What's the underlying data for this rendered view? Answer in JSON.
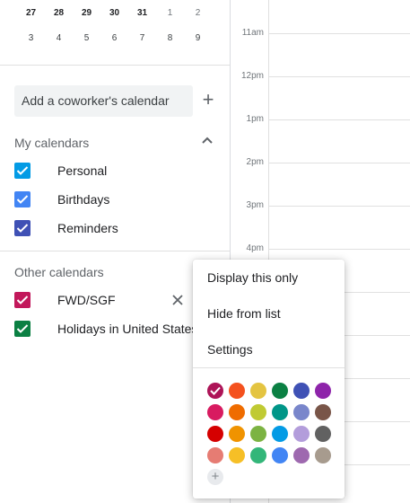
{
  "mini_calendar": {
    "row1": [
      {
        "d": "27"
      },
      {
        "d": "28"
      },
      {
        "d": "29"
      },
      {
        "d": "30"
      },
      {
        "d": "31"
      },
      {
        "d": "1"
      },
      {
        "d": "2"
      }
    ],
    "row2": [
      {
        "d": "3"
      },
      {
        "d": "4"
      },
      {
        "d": "5"
      },
      {
        "d": "6"
      },
      {
        "d": "7"
      },
      {
        "d": "8"
      },
      {
        "d": "9"
      }
    ]
  },
  "coworker": {
    "placeholder": "Add a coworker's calendar",
    "add_icon": "plus-icon"
  },
  "my_calendars": {
    "title": "My calendars",
    "items": [
      {
        "label": "Personal",
        "color": "#039be5"
      },
      {
        "label": "Birthdays",
        "color": "#4285f4"
      },
      {
        "label": "Reminders",
        "color": "#3f51b5"
      }
    ]
  },
  "other_calendars": {
    "title": "Other calendars",
    "items": [
      {
        "label": "FWD/SGF",
        "color": "#c2185b"
      },
      {
        "label": "Holidays in United States",
        "color": "#0b8043"
      }
    ]
  },
  "time_grid": {
    "hours": [
      "11am",
      "12pm",
      "1pm",
      "2pm",
      "3pm",
      "4pm"
    ]
  },
  "context_menu": {
    "items": [
      "Display this only",
      "Hide from list",
      "Settings"
    ],
    "selected_color": "#ad1457",
    "colors": [
      [
        "#ad1457",
        "#f4511e",
        "#e4c441",
        "#0b8043",
        "#3f51b5",
        "#8e24aa"
      ],
      [
        "#d81b60",
        "#ef6c00",
        "#c0ca33",
        "#009688",
        "#7986cb",
        "#795548"
      ],
      [
        "#d50000",
        "#f09300",
        "#7cb342",
        "#039be5",
        "#b39ddb",
        "#616161"
      ],
      [
        "#e67c73",
        "#f6bf26",
        "#33b679",
        "#4285f4",
        "#9e69af",
        "#a79b8e"
      ]
    ],
    "add_icon": "+"
  }
}
